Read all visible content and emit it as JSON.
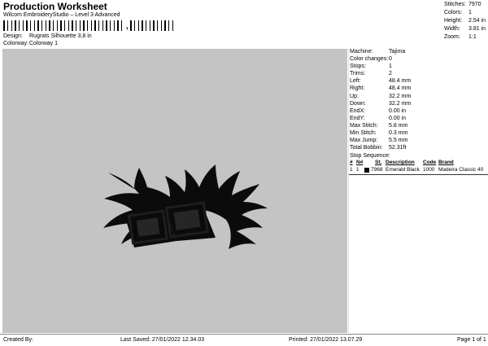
{
  "header": {
    "title": "Production Worksheet",
    "subtitle": "Wilcom EmbroideryStudio – Level 3 Advanced",
    "barcode_separator": ",",
    "design_label": "Design:",
    "design_value": "Rugrats Silhouette 3,8 in",
    "colorway_label": "Colorway:",
    "colorway_value": "Colorway 1"
  },
  "stats": [
    {
      "label": "Stitches:",
      "value": "7970"
    },
    {
      "label": "Colors:",
      "value": "1"
    },
    {
      "label": "Height:",
      "value": "2.54 in"
    },
    {
      "label": "Width:",
      "value": "3.81 in"
    },
    {
      "label": "Zoom:",
      "value": "1:1"
    }
  ],
  "info": [
    {
      "label": "Machine:",
      "value": "Tajima"
    },
    {
      "label": "Color changes:",
      "value": "0"
    },
    {
      "label": "Stops:",
      "value": "1"
    },
    {
      "label": "Trims:",
      "value": "2"
    },
    {
      "label": "Left:",
      "value": "48.4 mm"
    },
    {
      "label": "Right:",
      "value": "48.4 mm"
    },
    {
      "label": "Up:",
      "value": "32.2 mm"
    },
    {
      "label": "Down:",
      "value": "32.2 mm"
    },
    {
      "label": "EndX:",
      "value": "0.00 in"
    },
    {
      "label": "EndY:",
      "value": "0.00 in"
    },
    {
      "label": "Max Stitch:",
      "value": "5.8 mm"
    },
    {
      "label": "Min Stitch:",
      "value": "0.3 mm"
    },
    {
      "label": "Max Jump:",
      "value": "5.5 mm"
    },
    {
      "label": "Total Bobbin:",
      "value": "52.31ft"
    }
  ],
  "stop_sequence": {
    "title": "Stop Sequence:",
    "headers": [
      "#",
      "N#",
      "St.",
      "Description",
      "Code",
      "Brand"
    ],
    "rows": [
      {
        "num": "1",
        "n": "1",
        "stitches": "7968",
        "description": "Emerald Black",
        "code": "1000",
        "brand": "Madeira Classic 40",
        "color": "#0b0b0b"
      }
    ]
  },
  "footer": {
    "created_by": "Created By:",
    "last_saved": "Last Saved: 27/01/2022 12.34.03",
    "printed": "Printed: 27/01/2022 13.07.29",
    "page": "Page 1 of 1"
  },
  "colors": {
    "canvas_bg": "#c4c4c4",
    "thread": "#0b0b0b"
  }
}
